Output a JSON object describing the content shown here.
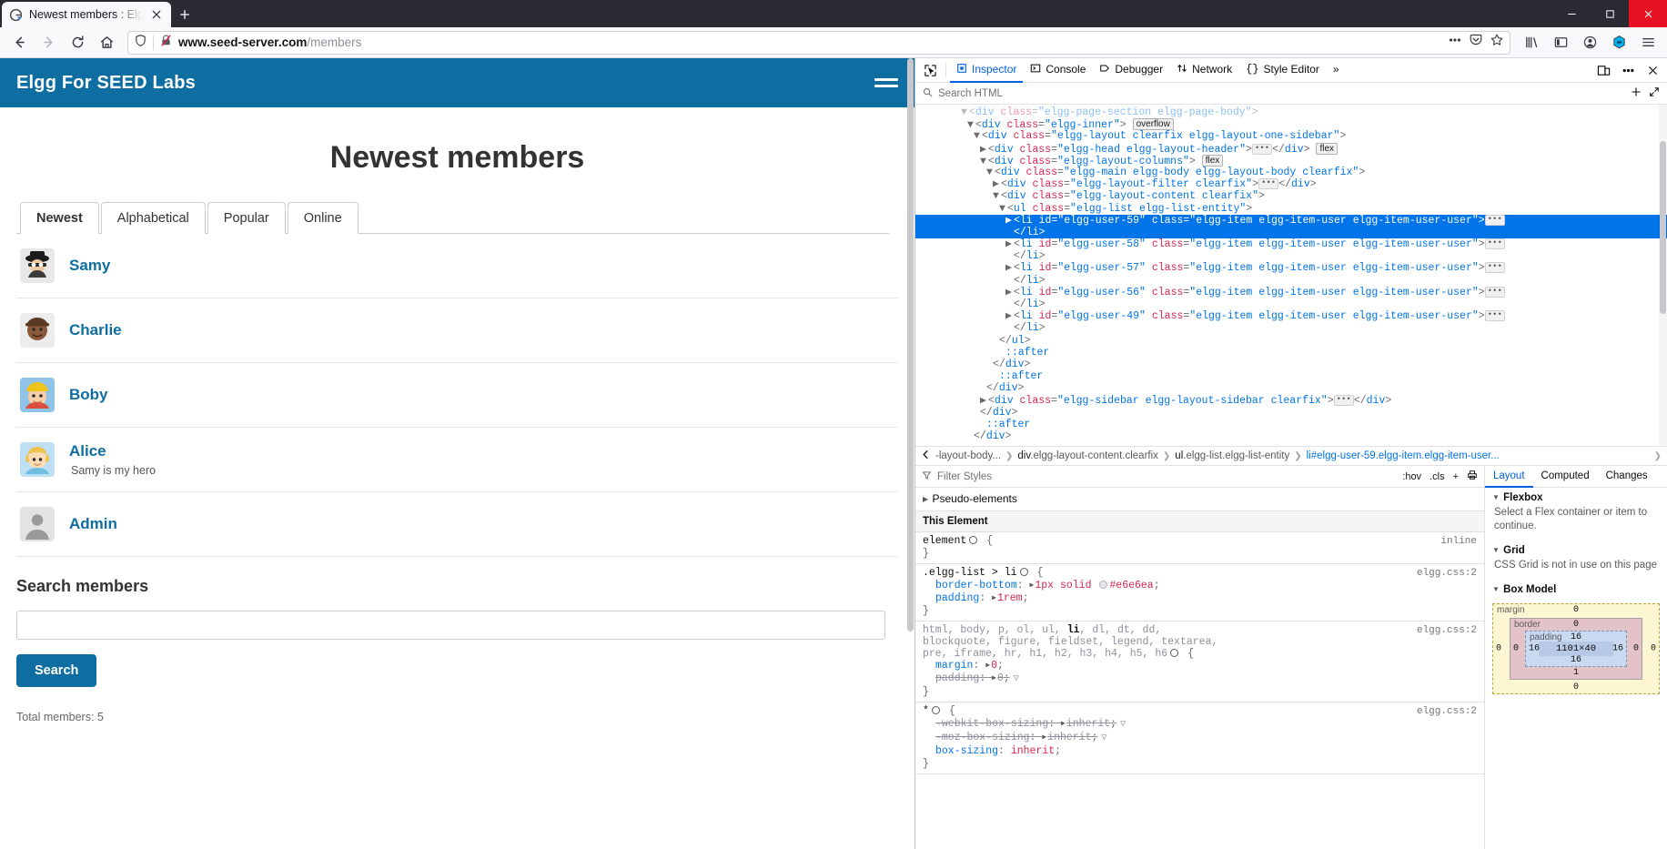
{
  "browser": {
    "tab": {
      "title": "Newest members : Elgg F",
      "favicon": "elgg-favicon"
    },
    "newtab_label": "+",
    "url": {
      "domain": "www.seed-server.com",
      "path": "/members"
    },
    "nav": {
      "back": "back-arrow-icon",
      "forward": "forward-arrow-icon",
      "reload": "reload-icon",
      "home": "home-icon"
    },
    "url_icons": [
      "shield-icon",
      "no-https-icon"
    ],
    "url_actions": [
      "more-dots-icon",
      "pocket-icon",
      "bookmark-star-icon"
    ],
    "toolbar_icons": [
      "library-icon",
      "sidebar-icon",
      "account-icon",
      "extension-icon",
      "app-menu-icon"
    ],
    "window_controls": [
      "minimize",
      "maximize",
      "close"
    ]
  },
  "site": {
    "title": "Elgg For SEED Labs",
    "menu_label": "hamburger-menu",
    "page_title": "Newest members",
    "tabs": [
      {
        "label": "Newest",
        "active": true
      },
      {
        "label": "Alphabetical",
        "active": false
      },
      {
        "label": "Popular",
        "active": false
      },
      {
        "label": "Online",
        "active": false
      }
    ],
    "members": [
      {
        "name": "Samy",
        "sub": "",
        "avatar": "avatar-samy"
      },
      {
        "name": "Charlie",
        "sub": "",
        "avatar": "avatar-charlie"
      },
      {
        "name": "Boby",
        "sub": "",
        "avatar": "avatar-boby"
      },
      {
        "name": "Alice",
        "sub": "Samy is my hero",
        "avatar": "avatar-alice"
      },
      {
        "name": "Admin",
        "sub": "",
        "avatar": "avatar-admin"
      }
    ],
    "search": {
      "heading": "Search members",
      "value": "",
      "placeholder": "",
      "button": "Search"
    },
    "total_members": "Total members: 5",
    "accent": "#0f6ea1"
  },
  "devtools": {
    "tabs": [
      {
        "label": "Inspector",
        "icon": "inspector-icon",
        "active": true
      },
      {
        "label": "Console",
        "icon": "console-icon",
        "active": false
      },
      {
        "label": "Debugger",
        "icon": "debugger-icon",
        "active": false
      },
      {
        "label": "Network",
        "icon": "network-icon",
        "active": false
      },
      {
        "label": "Style Editor",
        "icon": "style-editor-icon",
        "active": false
      }
    ],
    "overflow_label": "»",
    "picker_icon": "element-picker-icon",
    "right_icons": [
      "responsive-design-icon",
      "meatball-menu-icon",
      "close-devtools-icon"
    ],
    "search": {
      "placeholder": "Search HTML"
    },
    "search_actions": [
      "add-node-icon",
      "expand-icon"
    ],
    "markup": [
      {
        "indent": 3,
        "twisty": "down",
        "text": "<div class=\"elgg-page-section elgg-page-body\">",
        "faded": true
      },
      {
        "indent": 4,
        "twisty": "down",
        "tag": "div",
        "attr": "class",
        "val": "elgg-inner",
        "badge": "overflow"
      },
      {
        "indent": 5,
        "twisty": "down",
        "tag": "div",
        "attr": "class",
        "val": "elgg-layout clearfix elgg-layout-one-sidebar"
      },
      {
        "indent": 6,
        "twisty": "right",
        "tag": "div",
        "attr": "class",
        "val": "elgg-head elgg-layout-header",
        "ellipsis": true,
        "close": "</div>",
        "badge": "flex"
      },
      {
        "indent": 6,
        "twisty": "down",
        "tag": "div",
        "attr": "class",
        "val": "elgg-layout-columns",
        "badge": "flex"
      },
      {
        "indent": 7,
        "twisty": "down",
        "tag": "div",
        "attr": "class",
        "val": "elgg-main elgg-body elgg-layout-body clearfix"
      },
      {
        "indent": 8,
        "twisty": "right",
        "tag": "div",
        "attr": "class",
        "val": "elgg-layout-filter clearfix",
        "ellipsis": true,
        "close": "</div>"
      },
      {
        "indent": 8,
        "twisty": "down",
        "tag": "div",
        "attr": "class",
        "val": "elgg-layout-content clearfix"
      },
      {
        "indent": 9,
        "twisty": "down",
        "tag": "ul",
        "attr": "class",
        "val": "elgg-list elgg-list-entity"
      },
      {
        "indent": 10,
        "twisty": "right",
        "tag": "li",
        "attr": "id",
        "val": "elgg-user-59",
        "attr2": "class",
        "val2": "elgg-item elgg-item-user elgg-item-user-user",
        "ellipsis": true,
        "selected": true
      },
      {
        "indent": 10,
        "text_close": "</li>",
        "selected": true
      },
      {
        "indent": 10,
        "twisty": "right",
        "tag": "li",
        "attr": "id",
        "val": "elgg-user-58",
        "attr2": "class",
        "val2": "elgg-item elgg-item-user elgg-item-user-user",
        "ellipsis": true
      },
      {
        "indent": 10,
        "text_close": "</li>"
      },
      {
        "indent": 10,
        "twisty": "right",
        "tag": "li",
        "attr": "id",
        "val": "elgg-user-57",
        "attr2": "class",
        "val2": "elgg-item elgg-item-user elgg-item-user-user",
        "ellipsis": true
      },
      {
        "indent": 10,
        "text_close": "</li>"
      },
      {
        "indent": 10,
        "twisty": "right",
        "tag": "li",
        "attr": "id",
        "val": "elgg-user-56",
        "attr2": "class",
        "val2": "elgg-item elgg-item-user elgg-item-user-user",
        "ellipsis": true
      },
      {
        "indent": 10,
        "text_close": "</li>"
      },
      {
        "indent": 10,
        "twisty": "right",
        "tag": "li",
        "attr": "id",
        "val": "elgg-user-49",
        "attr2": "class",
        "val2": "elgg-item elgg-item-user elgg-item-user-user",
        "ellipsis": true
      },
      {
        "indent": 10,
        "text_close": "</li>"
      },
      {
        "indent": 9,
        "text_close": "</ul>"
      },
      {
        "indent": 9,
        "pseudo": "::after"
      },
      {
        "indent": 8,
        "text_close": "</div>"
      },
      {
        "indent": 8,
        "pseudo": "::after"
      },
      {
        "indent": 7,
        "text_close": "</div>"
      },
      {
        "indent": 7,
        "twisty": "right",
        "tag": "div",
        "attr": "class",
        "val": "elgg-sidebar elgg-layout-sidebar clearfix",
        "ellipsis": true,
        "close": "</div>"
      },
      {
        "indent": 6,
        "text_close": "</div>"
      },
      {
        "indent": 6,
        "pseudo": "::after"
      },
      {
        "indent": 5,
        "text_close": "</div>"
      }
    ],
    "breadcrumb": [
      {
        "label": "-layout-body...",
        "active": false,
        "truncated": true
      },
      {
        "label": "div.elgg-layout-content.clearfix",
        "bold": "div",
        "active": false
      },
      {
        "label": "ul.elgg-list.elgg-list-entity",
        "bold": "ul",
        "active": false
      },
      {
        "label": "li#elgg-user-59.elgg-item.elgg-item-user...",
        "bold": "li",
        "active": true
      }
    ],
    "styles": {
      "filter_placeholder": "Filter Styles",
      "actions": [
        ":hov",
        ".cls",
        "+",
        "print-icon"
      ],
      "pseudo_elements": "Pseudo-elements",
      "this_element": "This Element",
      "rules": [
        {
          "selector": "element",
          "source": "inline",
          "declarations": []
        },
        {
          "selector": ".elgg-list > li",
          "source": "elgg.css:2",
          "declarations": [
            {
              "property": "border-bottom",
              "value": "1px solid",
              "color": "#e6e6ea",
              "expandable": true
            },
            {
              "property": "padding",
              "value": "1rem",
              "expandable": true
            }
          ]
        },
        {
          "selector": "html, body, p, ol, ul, li, dl, dt, dd, blockquote, figure, fieldset, legend, textarea, pre, iframe, hr, h1, h2, h3, h4, h5, h6",
          "source": "elgg.css:2",
          "declarations": [
            {
              "property": "margin",
              "value": "0",
              "expandable": true
            },
            {
              "property": "padding",
              "value": "0",
              "expandable": true,
              "overridden": true
            }
          ]
        },
        {
          "selector": "*",
          "source": "elgg.css:2",
          "declarations": [
            {
              "property": "-webkit-box-sizing",
              "value": "inherit",
              "expandable": true,
              "overridden": true
            },
            {
              "property": "-moz-box-sizing",
              "value": "inherit",
              "expandable": true,
              "overridden": true
            },
            {
              "property": "box-sizing",
              "value": "inherit"
            }
          ]
        }
      ]
    },
    "layout_panel": {
      "tabs": [
        {
          "label": "Layout",
          "active": true
        },
        {
          "label": "Computed",
          "active": false
        },
        {
          "label": "Changes",
          "active": false
        }
      ],
      "flexbox": {
        "title": "Flexbox",
        "message": "Select a Flex container or item to continue."
      },
      "grid": {
        "title": "Grid",
        "message": "CSS Grid is not in use on this page"
      },
      "box_model": {
        "title": "Box Model",
        "margin_label": "margin",
        "border_label": "border",
        "padding_label": "padding",
        "content": "1101×40",
        "margin": {
          "top": "0",
          "right": "0",
          "bottom": "0",
          "left": "0"
        },
        "border": {
          "top": "0",
          "right": "0",
          "bottom": "1",
          "left": "0"
        },
        "padding": {
          "top": "16",
          "right": "16",
          "bottom": "16",
          "left": "16"
        }
      }
    }
  }
}
